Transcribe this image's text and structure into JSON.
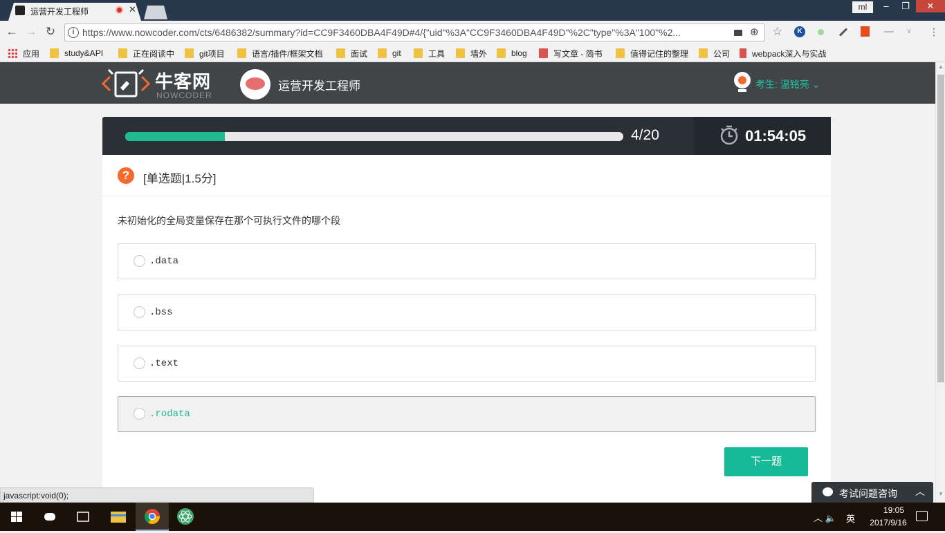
{
  "browser": {
    "tab_title": "运营开发工程师",
    "profile": "ml",
    "url": "https://www.nowcoder.com/cts/6486382/summary?id=CC9F3460DBA4F49D#4/{\"uid\"%3A\"CC9F3460DBA4F49D\"%2C\"type\"%3A\"100\"%2...",
    "bookmarks": [
      "应用",
      "study&API",
      "正在阅读中",
      "git项目",
      "语言/插件/框架文档",
      "面试",
      "git",
      "工具",
      "墙外",
      "blog",
      "写文章 - 简书",
      "值得记住的整理",
      "公司",
      "webpack深入与实战"
    ]
  },
  "site": {
    "logo_cn": "牛客网",
    "logo_en": "NOWCODER",
    "exam_title": "运营开发工程师",
    "user_label": "考生: 温铭亮",
    "accent": "#1fb992"
  },
  "progress": {
    "current": 4,
    "total": 20,
    "text": "4/20",
    "fill_fraction": 0.2
  },
  "timer": {
    "text": "01:54:05"
  },
  "question": {
    "type_label": "[单选题|1.5分]",
    "text": "未初始化的全局变量保存在那个可执行文件的哪个段",
    "options": [
      ".data",
      ".bss",
      ".text",
      ".rodata"
    ],
    "hovered_index": 3
  },
  "next_label": "下一题",
  "status_text": "javascript:void(0);",
  "consult_label": "考试问题咨询",
  "taskbar": {
    "ime": "英",
    "time": "19:05",
    "date": "2017/9/16"
  }
}
